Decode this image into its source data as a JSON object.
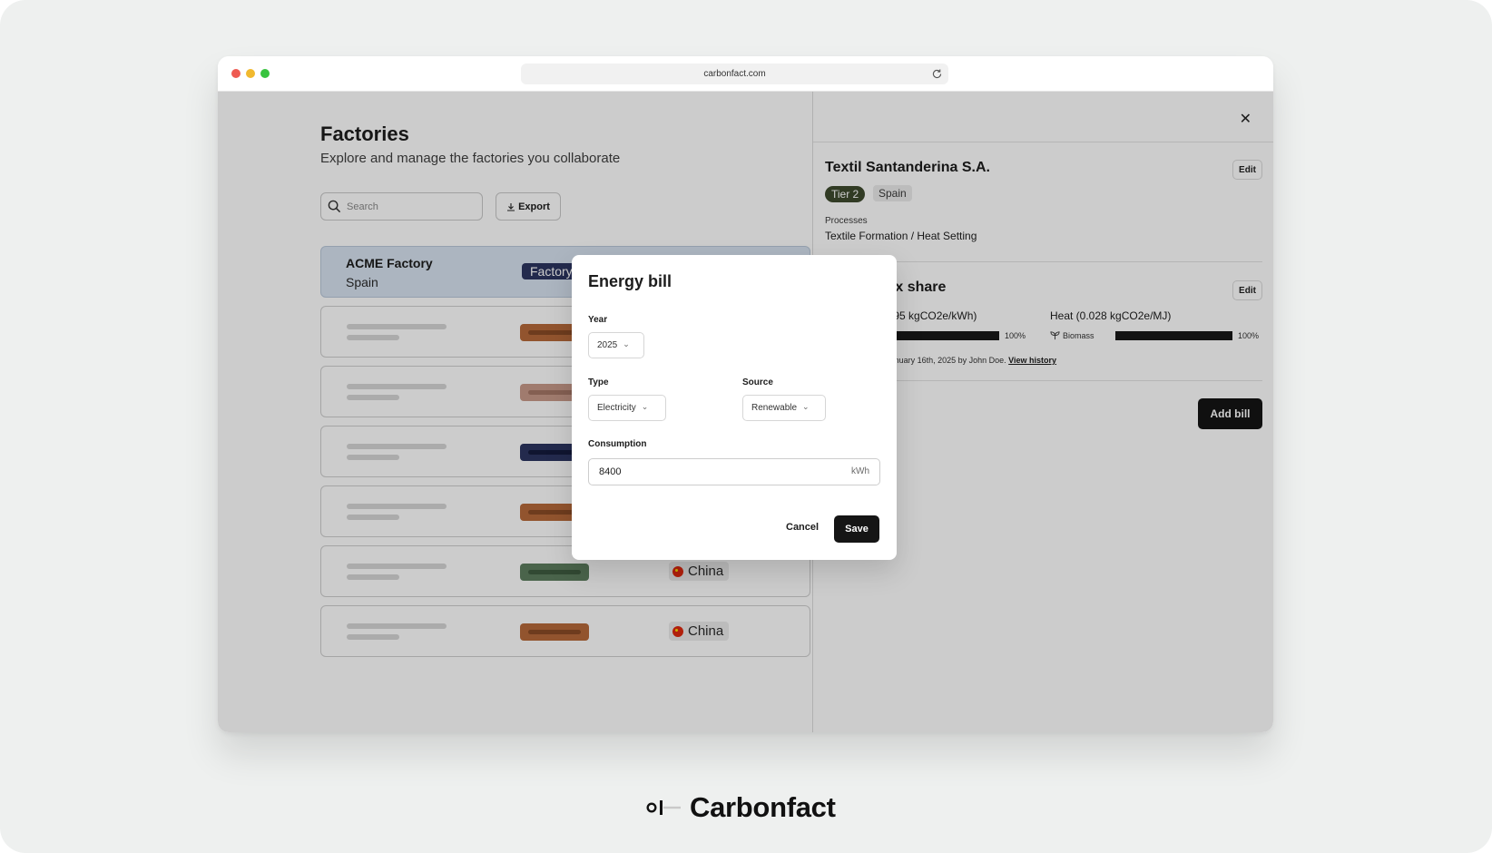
{
  "browser": {
    "url": "carbonfact.com"
  },
  "page": {
    "title": "Factories",
    "subtitle": "Explore and manage the factories you collaborate",
    "search_placeholder": "Search",
    "export_label": "Export",
    "rows": [
      {
        "name": "ACME Factory",
        "country": "Spain",
        "tag": "Factory",
        "selected": true
      },
      {
        "pill_color": "#b76a3a",
        "pill_inner": "#8a4b26"
      },
      {
        "pill_color": "#c99a8a",
        "pill_inner": "#a67767"
      },
      {
        "pill_color": "#2c3561",
        "pill_inner": "#141b3d"
      },
      {
        "pill_color": "#b76a3a",
        "pill_inner": "#8a4b26"
      },
      {
        "pill_color": "#5d7d5e",
        "pill_inner": "#3f5c40",
        "country": "China"
      },
      {
        "pill_color": "#b76a3a",
        "pill_inner": "#8a4b26",
        "country": "China"
      }
    ]
  },
  "panel": {
    "close_icon": "close-icon",
    "factory_name": "Textil Santanderina S.A.",
    "edit_label": "Edit",
    "tier": "Tier 2",
    "country": "Spain",
    "processes_label": "Processes",
    "processes_value": "Textile Formation / Heat Setting",
    "mix_title": "Energy mix share",
    "electricity_title": "Electricity (0.195 kgCO2e/kWh)",
    "electricity_pct": "100%",
    "heat_title": "Heat (0.028 kgCO2e/MJ)",
    "heat_source": "Biomass",
    "heat_pct": "100%",
    "updated_text": "Last updated on January 16th, 2025 by John Doe.",
    "view_history": "View history",
    "add_bill": "Add bill"
  },
  "modal": {
    "title": "Energy bill",
    "year_label": "Year",
    "year_value": "2025",
    "type_label": "Type",
    "type_value": "Electricity",
    "source_label": "Source",
    "source_value": "Renewable",
    "consumption_label": "Consumption",
    "consumption_value": "8400",
    "consumption_unit": "kWh",
    "cancel": "Cancel",
    "save": "Save"
  },
  "brand": {
    "name": "Carbonfact"
  }
}
